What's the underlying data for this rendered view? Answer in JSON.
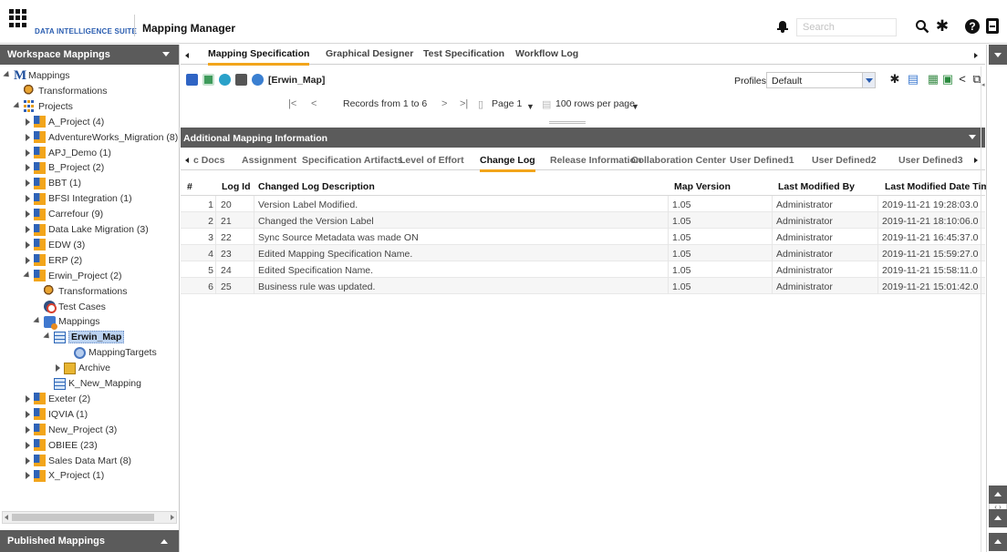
{
  "topbar": {
    "brand": "DATA INTELLIGENCE SUITE",
    "app_title": "Mapping Manager",
    "search_placeholder": "Search"
  },
  "left_panel": {
    "header": "Workspace Mappings",
    "footer": "Published Mappings",
    "tree": [
      {
        "label": "Mappings",
        "level": 0,
        "toggle": "expanded",
        "icon": "mappings-root-icon"
      },
      {
        "label": "Transformations",
        "level": 1,
        "toggle": "none",
        "icon": "transformations-icon"
      },
      {
        "label": "Projects",
        "level": 1,
        "toggle": "expanded",
        "icon": "projects-icon"
      },
      {
        "label": "A_Project (4)",
        "level": 2,
        "toggle": "collapsed",
        "icon": "project-icon"
      },
      {
        "label": "AdventureWorks_Migration (8)",
        "level": 2,
        "toggle": "collapsed",
        "icon": "project-icon"
      },
      {
        "label": "APJ_Demo (1)",
        "level": 2,
        "toggle": "collapsed",
        "icon": "project-icon"
      },
      {
        "label": "B_Project (2)",
        "level": 2,
        "toggle": "collapsed",
        "icon": "project-icon"
      },
      {
        "label": "BBT (1)",
        "level": 2,
        "toggle": "collapsed",
        "icon": "project-icon"
      },
      {
        "label": "BFSI Integration (1)",
        "level": 2,
        "toggle": "collapsed",
        "icon": "project-icon"
      },
      {
        "label": "Carrefour (9)",
        "level": 2,
        "toggle": "collapsed",
        "icon": "project-icon"
      },
      {
        "label": "Data Lake Migration (3)",
        "level": 2,
        "toggle": "collapsed",
        "icon": "project-icon"
      },
      {
        "label": "EDW (3)",
        "level": 2,
        "toggle": "collapsed",
        "icon": "project-icon"
      },
      {
        "label": "ERP (2)",
        "level": 2,
        "toggle": "collapsed",
        "icon": "project-icon"
      },
      {
        "label": "Erwin_Project (2)",
        "level": 2,
        "toggle": "expanded",
        "icon": "project-icon"
      },
      {
        "label": "Transformations",
        "level": 3,
        "toggle": "none",
        "icon": "transformations-icon"
      },
      {
        "label": "Test Cases",
        "level": 3,
        "toggle": "none",
        "icon": "test-cases-icon"
      },
      {
        "label": "Mappings",
        "level": 3,
        "toggle": "expanded",
        "icon": "mappings-folder-icon"
      },
      {
        "label": "Erwin_Map",
        "level": 4,
        "toggle": "expanded",
        "icon": "mapping-table-icon",
        "selected": true
      },
      {
        "label": "MappingTargets",
        "level": 6,
        "toggle": "none",
        "icon": "mapping-targets-icon"
      },
      {
        "label": "Archive",
        "level": 5,
        "toggle": "collapsed",
        "icon": "archive-icon"
      },
      {
        "label": "K_New_Mapping",
        "level": 4,
        "toggle": "none",
        "icon": "mapping-table-icon"
      },
      {
        "label": "Exeter (2)",
        "level": 2,
        "toggle": "collapsed",
        "icon": "project-icon"
      },
      {
        "label": "IQVIA (1)",
        "level": 2,
        "toggle": "collapsed",
        "icon": "project-icon"
      },
      {
        "label": "New_Project (3)",
        "level": 2,
        "toggle": "collapsed",
        "icon": "project-icon"
      },
      {
        "label": "OBIEE (23)",
        "level": 2,
        "toggle": "collapsed",
        "icon": "project-icon"
      },
      {
        "label": "Sales Data Mart (8)",
        "level": 2,
        "toggle": "collapsed",
        "icon": "project-icon"
      },
      {
        "label": "X_Project (1)",
        "level": 2,
        "toggle": "collapsed",
        "icon": "project-icon"
      }
    ]
  },
  "doc_tabs": [
    {
      "label": "Mapping Specification",
      "active": true
    },
    {
      "label": "Graphical Designer",
      "active": false
    },
    {
      "label": "Test Specification",
      "active": false
    },
    {
      "label": "Workflow Log",
      "active": false
    }
  ],
  "toolbar": {
    "spec_name": "[Erwin_Map]",
    "profiles_label": "Profiles:",
    "profile_value": "Default"
  },
  "pager": {
    "records_text": "Records from 1 to 6",
    "page_text": "Page 1",
    "rows_per_page": "100 rows per page"
  },
  "section": {
    "title": "Additional Mapping Information"
  },
  "sub_tabs": [
    {
      "label": "c Docs",
      "active": false
    },
    {
      "label": "Assignment",
      "active": false
    },
    {
      "label": "Specification Artifacts",
      "active": false
    },
    {
      "label": "Level of Effort",
      "active": false
    },
    {
      "label": "Change Log",
      "active": true
    },
    {
      "label": "Release Information",
      "active": false
    },
    {
      "label": "Collaboration Center",
      "active": false
    },
    {
      "label": "User Defined1",
      "active": false
    },
    {
      "label": "User Defined2",
      "active": false
    },
    {
      "label": "User Defined3",
      "active": false
    }
  ],
  "grid": {
    "columns": [
      "#",
      "Log Id",
      "Changed Log Description",
      "Map Version",
      "Last Modified By",
      "Last Modified Date Time"
    ],
    "rows": [
      {
        "num": "1",
        "log_id": "20",
        "description": "Version Label Modified.",
        "version": "1.05",
        "by": "Administrator",
        "when": "2019-11-21 19:28:03.0"
      },
      {
        "num": "2",
        "log_id": "21",
        "description": "Changed the Version Label",
        "version": "1.05",
        "by": "Administrator",
        "when": "2019-11-21 18:10:06.0"
      },
      {
        "num": "3",
        "log_id": "22",
        "description": "Sync Source Metadata was made ON",
        "version": "1.05",
        "by": "Administrator",
        "when": "2019-11-21 16:45:37.0"
      },
      {
        "num": "4",
        "log_id": "23",
        "description": "Edited Mapping Specification Name.",
        "version": "1.05",
        "by": "Administrator",
        "when": "2019-11-21 15:59:27.0"
      },
      {
        "num": "5",
        "log_id": "24",
        "description": "Edited Specification Name.",
        "version": "1.05",
        "by": "Administrator",
        "when": "2019-11-21 15:58:11.0"
      },
      {
        "num": "6",
        "log_id": "25",
        "description": "Business rule was updated.",
        "version": "1.05",
        "by": "Administrator",
        "when": "2019-11-21 15:01:42.0"
      }
    ]
  },
  "colors": {
    "accent": "#f2a51b",
    "header_bg": "#5b5b5b",
    "brand": "#2a5db0",
    "selection": "#bcd3f1"
  }
}
